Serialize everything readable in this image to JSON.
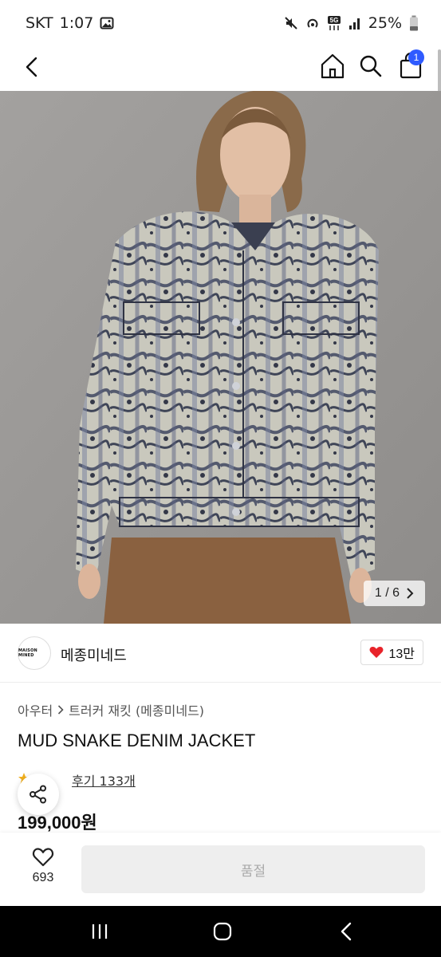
{
  "status_bar": {
    "carrier": "SKT",
    "time": "1:07",
    "battery": "25%",
    "network": "5G"
  },
  "nav": {
    "cart_count": "1"
  },
  "product": {
    "image_counter": "1 / 6",
    "brand_logo_text": "MAISON MINED",
    "brand_name": "메종미네드",
    "likes": "13만",
    "breadcrumb": [
      "아우터",
      "트러커 재킷 (메종미네드)"
    ],
    "title": "MUD SNAKE DENIM JACKET",
    "review_label": "후기 133개",
    "price": "199,000원"
  },
  "bottom": {
    "wish_count": "693",
    "action_label": "품절"
  },
  "colors": {
    "accent": "#2f5bff",
    "heart": "#e8232a",
    "disabled_bg": "#eeeeee"
  }
}
